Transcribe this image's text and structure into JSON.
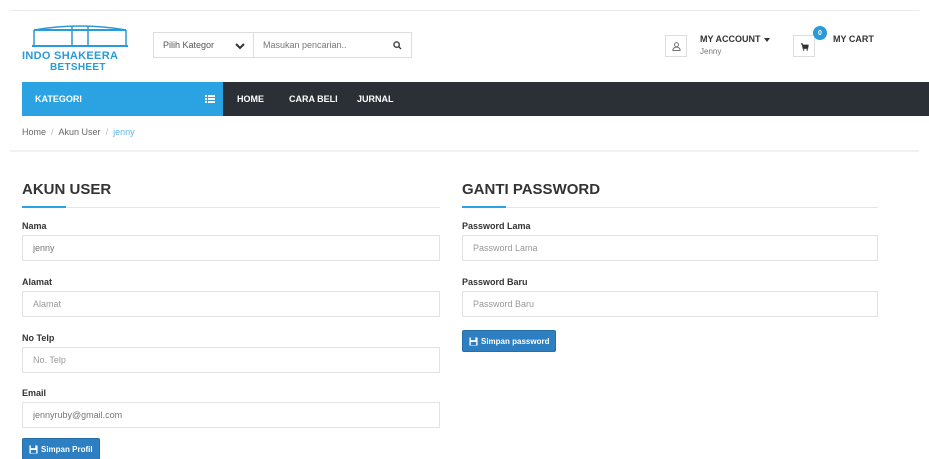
{
  "header": {
    "logo_line1": "INDO SHAKEERA",
    "logo_line2": "BETSHEET",
    "category_select": "Pilih Kategor",
    "search_placeholder": "Masukan pencarian..",
    "account_title": "MY ACCOUNT",
    "account_user": "Jenny",
    "cart_count": "0",
    "cart_label": "MY CART"
  },
  "nav": {
    "kategori": "KATEGORI",
    "items": [
      "HOME",
      "CARA BELI",
      "JURNAL"
    ]
  },
  "breadcrumb": [
    "Home",
    "Akun User",
    "jenny"
  ],
  "akun_user": {
    "title": "AKUN USER",
    "fields": [
      {
        "label": "Nama",
        "value": "jenny",
        "placeholder": ""
      },
      {
        "label": "Alamat",
        "value": "",
        "placeholder": "Alamat"
      },
      {
        "label": "No Telp",
        "value": "",
        "placeholder": "No. Telp"
      },
      {
        "label": "Email",
        "value": "jennyruby@gmail.com",
        "placeholder": ""
      }
    ],
    "button": "Simpan Profil"
  },
  "ganti_password": {
    "title": "GANTI PASSWORD",
    "fields": [
      {
        "label": "Password Lama",
        "value": "",
        "placeholder": "Password Lama"
      },
      {
        "label": "Password Baru",
        "value": "",
        "placeholder": "Password Baru"
      }
    ],
    "button": "Simpan password"
  },
  "colors": {
    "accent": "#2ba3e3",
    "navbar": "#2b2f36",
    "button": "#2d7fc1",
    "logo": "#2a9ad8"
  },
  "icons": [
    "bridge-logo-icon",
    "chevron-down-icon",
    "search-icon",
    "user-icon",
    "cart-icon",
    "menu-icon",
    "save-icon"
  ]
}
